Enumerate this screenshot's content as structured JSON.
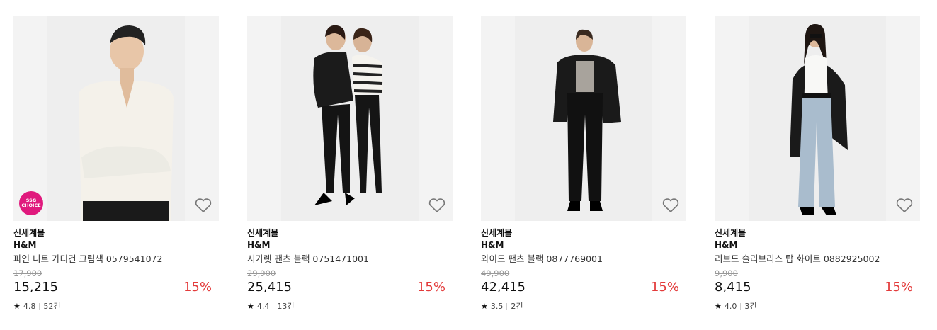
{
  "products": [
    {
      "store": "신세계몰",
      "brand": "H&M",
      "name": "파인 니트 가디건 크림색 0579541072",
      "original_price": "17,900",
      "price": "15,215",
      "discount": "15%",
      "rating": "4.8",
      "reviews": "52건",
      "badge": [
        "SSG",
        "CHOICE"
      ]
    },
    {
      "store": "신세계몰",
      "brand": "H&M",
      "name": "시가렛 팬츠 블랙 0751471001",
      "original_price": "29,900",
      "price": "25,415",
      "discount": "15%",
      "rating": "4.4",
      "reviews": "13건"
    },
    {
      "store": "신세계몰",
      "brand": "H&M",
      "name": "와이드 팬츠 블랙 0877769001",
      "original_price": "49,900",
      "price": "42,415",
      "discount": "15%",
      "rating": "3.5",
      "reviews": "2건"
    },
    {
      "store": "신세계몰",
      "brand": "H&M",
      "name": "리브드 슬리브리스 탑 화이트 0882925002",
      "original_price": "9,900",
      "price": "8,415",
      "discount": "15%",
      "rating": "4.0",
      "reviews": "3건"
    }
  ],
  "colors": {
    "discount": "#e33b3b",
    "badge": "#e0197d",
    "image_bg": "#f3f3f3"
  },
  "icons": {
    "wishlist": "heart-outline-icon",
    "rating": "star-icon"
  }
}
